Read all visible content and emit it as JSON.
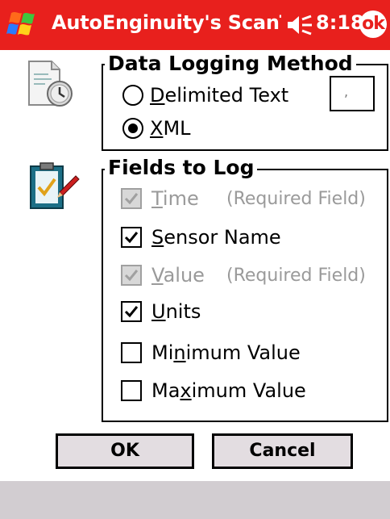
{
  "titlebar": {
    "title": "AutoEnginuity's ScanTo",
    "time": "8:18",
    "ok_label": "ok",
    "color": "#e8201d"
  },
  "logging": {
    "legend": "Data Logging Method",
    "option_delimited": "Delimited Text",
    "option_xml": "XML",
    "selected": "XML",
    "delimiter_value": ","
  },
  "fields": {
    "legend": "Fields to Log",
    "items": [
      {
        "label": "Time",
        "checked": true,
        "disabled": true,
        "note": "(Required Field)"
      },
      {
        "label": "Sensor Name",
        "checked": true,
        "disabled": false
      },
      {
        "label": "Value",
        "checked": true,
        "disabled": true,
        "note": "(Required Field)"
      },
      {
        "label": "Units",
        "checked": true,
        "disabled": false
      },
      {
        "label": "Minimum Value",
        "checked": false,
        "disabled": false
      },
      {
        "label": "Maximum Value",
        "checked": false,
        "disabled": false
      }
    ]
  },
  "buttons": {
    "ok": "OK",
    "cancel": "Cancel"
  }
}
